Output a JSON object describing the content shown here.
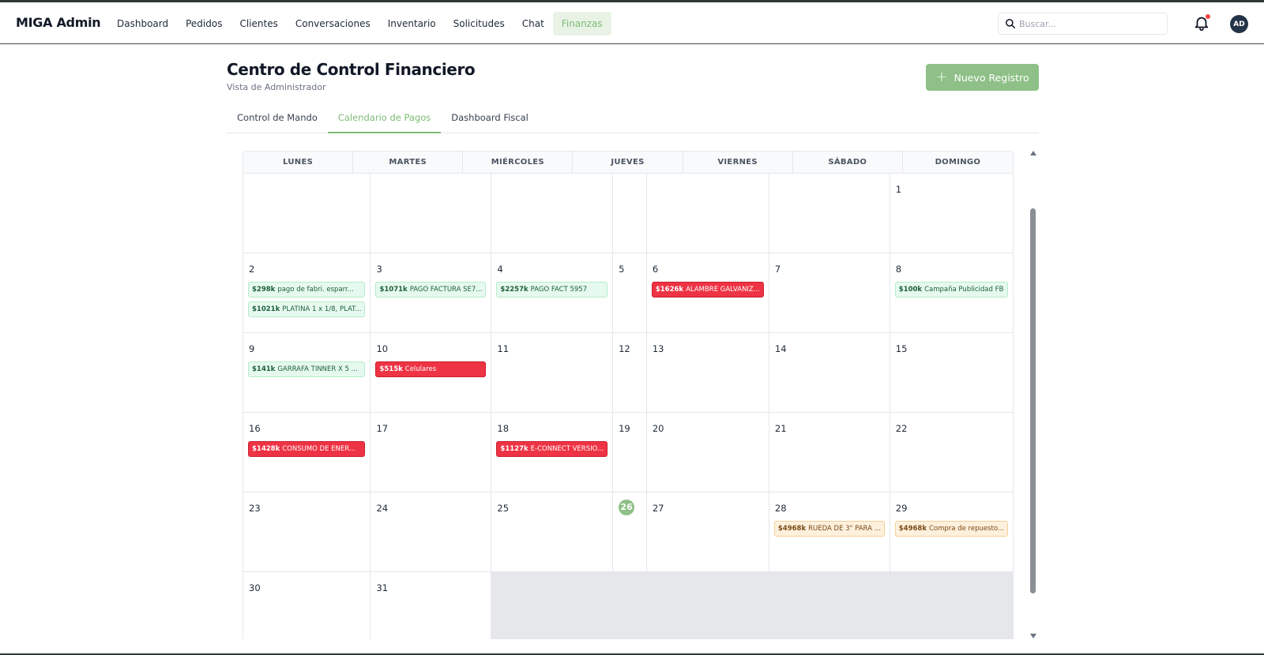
{
  "brand": "MIGA Admin",
  "nav": [
    {
      "label": "Dashboard",
      "active": false
    },
    {
      "label": "Pedidos",
      "active": false
    },
    {
      "label": "Clientes",
      "active": false
    },
    {
      "label": "Conversaciones",
      "active": false
    },
    {
      "label": "Inventario",
      "active": false
    },
    {
      "label": "Solicitudes",
      "active": false
    },
    {
      "label": "Chat",
      "active": false
    },
    {
      "label": "Finanzas",
      "active": true
    }
  ],
  "search": {
    "placeholder": "Buscar..."
  },
  "user": {
    "initials": "AD"
  },
  "header": {
    "title": "Centro de Control Financiero",
    "subtitle": "Vista de Administrador",
    "new_button": "Nuevo Registro"
  },
  "tabs": [
    {
      "label": "Control de Mando",
      "active": false
    },
    {
      "label": "Calendario de Pagos",
      "active": true
    },
    {
      "label": "Dashboard Fiscal",
      "active": false
    }
  ],
  "calendar": {
    "weekdays": [
      "LUNES",
      "MARTES",
      "MIÉRCOLES",
      "JUEVES",
      "VIERNES",
      "SÁBADO",
      "DOMINGO"
    ],
    "leading_blanks": 6,
    "days_in_month": 31,
    "today": 26,
    "events": {
      "2": [
        {
          "amount": "$298k",
          "label": "pago de fabri. esparr...",
          "status": "green"
        },
        {
          "amount": "$1021k",
          "label": "PLATINA 1 x 1/8, PLAT...",
          "status": "green"
        }
      ],
      "3": [
        {
          "amount": "$1071k",
          "label": "PAGO FACTURA SE7...",
          "status": "green"
        }
      ],
      "4": [
        {
          "amount": "$2257k",
          "label": "PAGO FACT 5957",
          "status": "green"
        }
      ],
      "6": [
        {
          "amount": "$1626k",
          "label": "ALAMBRE GALVANIZ...",
          "status": "red"
        }
      ],
      "8": [
        {
          "amount": "$100k",
          "label": "Campaña Publicidad FB",
          "status": "green"
        }
      ],
      "9": [
        {
          "amount": "$141k",
          "label": "GARRAFA TINNER X 5 ...",
          "status": "green"
        }
      ],
      "10": [
        {
          "amount": "$515k",
          "label": "Celulares",
          "status": "red"
        }
      ],
      "16": [
        {
          "amount": "$1428k",
          "label": "CONSUMO DE ENER...",
          "status": "red"
        }
      ],
      "18": [
        {
          "amount": "$1127k",
          "label": "E-CONNECT VERSIO...",
          "status": "red"
        }
      ],
      "28": [
        {
          "amount": "$4968k",
          "label": "RUEDA DE 3\" PARA ...",
          "status": "orange"
        }
      ],
      "29": [
        {
          "amount": "$4968k",
          "label": "Compra de repuesto...",
          "status": "orange"
        }
      ]
    }
  },
  "icons": {
    "search": "search-icon",
    "notifications": "bell-icon",
    "add": "plus-icon"
  },
  "colors": {
    "accent": "#8ec087",
    "paid": "#e6f9ee",
    "overdue": "#ee3344",
    "pending": "#fdf0dd"
  }
}
